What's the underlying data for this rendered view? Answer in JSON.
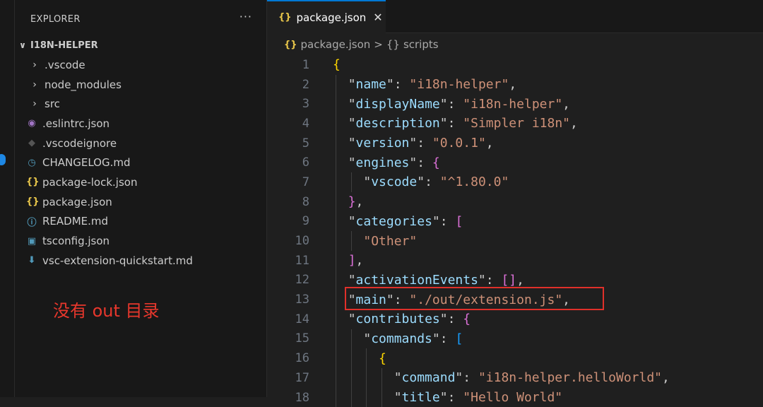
{
  "sidebar": {
    "title": "EXPLORER",
    "more": "···",
    "root": "I18N-HELPER",
    "items": [
      {
        "label": ".vscode",
        "type": "folder",
        "icon": "chevron-right",
        "glyph": "›",
        "color": "#cccccc"
      },
      {
        "label": "node_modules",
        "type": "folder",
        "icon": "chevron-right",
        "glyph": "›",
        "color": "#cccccc"
      },
      {
        "label": "src",
        "type": "folder",
        "icon": "chevron-right",
        "glyph": "›",
        "color": "#cccccc"
      },
      {
        "label": ".eslintrc.json",
        "type": "file",
        "icon": "eslint",
        "glyph": "◉",
        "color": "#a074c4"
      },
      {
        "label": ".vscodeignore",
        "type": "file",
        "icon": "vscodeignore",
        "glyph": "◆",
        "color": "#555555"
      },
      {
        "label": "CHANGELOG.md",
        "type": "file",
        "icon": "changelog",
        "glyph": "◷",
        "color": "#519aba"
      },
      {
        "label": "package-lock.json",
        "type": "file",
        "icon": "json",
        "glyph": "{}",
        "color": "#e8c64a"
      },
      {
        "label": "package.json",
        "type": "file",
        "icon": "json",
        "glyph": "{}",
        "color": "#e8c64a"
      },
      {
        "label": "README.md",
        "type": "file",
        "icon": "info",
        "glyph": "ⓘ",
        "color": "#519aba"
      },
      {
        "label": "tsconfig.json",
        "type": "file",
        "icon": "typescript",
        "glyph": "▣",
        "color": "#519aba"
      },
      {
        "label": "vsc-extension-quickstart.md",
        "type": "file",
        "icon": "download",
        "glyph": "⬇",
        "color": "#519aba"
      }
    ]
  },
  "annotation": "没有 out 目录",
  "tab": {
    "label": "package.json",
    "icon": "{}",
    "close": "✕"
  },
  "breadcrumb": {
    "file": "package.json",
    "sep": ">",
    "symbol_icon": "{}",
    "symbol": "scripts",
    "file_icon": "{}"
  },
  "code": [
    {
      "n": "1",
      "i": 0,
      "t": [
        [
          "{",
          "b1"
        ]
      ]
    },
    {
      "n": "2",
      "i": 1,
      "t": [
        [
          "\"",
          "q"
        ],
        [
          "name",
          "key"
        ],
        [
          "\"",
          "q"
        ],
        [
          ": ",
          "p"
        ],
        [
          "\"i18n-helper\"",
          "str"
        ],
        [
          ",",
          "p"
        ]
      ]
    },
    {
      "n": "3",
      "i": 1,
      "t": [
        [
          "\"",
          "q"
        ],
        [
          "displayName",
          "key"
        ],
        [
          "\"",
          "q"
        ],
        [
          ": ",
          "p"
        ],
        [
          "\"i18n-helper\"",
          "str"
        ],
        [
          ",",
          "p"
        ]
      ]
    },
    {
      "n": "4",
      "i": 1,
      "t": [
        [
          "\"",
          "q"
        ],
        [
          "description",
          "key"
        ],
        [
          "\"",
          "q"
        ],
        [
          ": ",
          "p"
        ],
        [
          "\"Simpler i18n\"",
          "str"
        ],
        [
          ",",
          "p"
        ]
      ]
    },
    {
      "n": "5",
      "i": 1,
      "t": [
        [
          "\"",
          "q"
        ],
        [
          "version",
          "key"
        ],
        [
          "\"",
          "q"
        ],
        [
          ": ",
          "p"
        ],
        [
          "\"0.0.1\"",
          "str"
        ],
        [
          ",",
          "p"
        ]
      ]
    },
    {
      "n": "6",
      "i": 1,
      "t": [
        [
          "\"",
          "q"
        ],
        [
          "engines",
          "key"
        ],
        [
          "\"",
          "q"
        ],
        [
          ": ",
          "p"
        ],
        [
          "{",
          "b2"
        ]
      ]
    },
    {
      "n": "7",
      "i": 2,
      "t": [
        [
          "\"",
          "q"
        ],
        [
          "vscode",
          "key"
        ],
        [
          "\"",
          "q"
        ],
        [
          ": ",
          "p"
        ],
        [
          "\"^1.80.0\"",
          "str"
        ]
      ]
    },
    {
      "n": "8",
      "i": 1,
      "t": [
        [
          "}",
          "b2"
        ],
        [
          ",",
          "p"
        ]
      ]
    },
    {
      "n": "9",
      "i": 1,
      "t": [
        [
          "\"",
          "q"
        ],
        [
          "categories",
          "key"
        ],
        [
          "\"",
          "q"
        ],
        [
          ": ",
          "p"
        ],
        [
          "[",
          "b2"
        ]
      ]
    },
    {
      "n": "10",
      "i": 2,
      "t": [
        [
          "\"Other\"",
          "str"
        ]
      ]
    },
    {
      "n": "11",
      "i": 1,
      "t": [
        [
          "]",
          "b2"
        ],
        [
          ",",
          "p"
        ]
      ]
    },
    {
      "n": "12",
      "i": 1,
      "t": [
        [
          "\"",
          "q"
        ],
        [
          "activationEvents",
          "key"
        ],
        [
          "\"",
          "q"
        ],
        [
          ": ",
          "p"
        ],
        [
          "[]",
          "b2"
        ],
        [
          ",",
          "p"
        ]
      ]
    },
    {
      "n": "13",
      "i": 1,
      "t": [
        [
          "\"",
          "q"
        ],
        [
          "main",
          "key"
        ],
        [
          "\"",
          "q"
        ],
        [
          ": ",
          "p"
        ],
        [
          "\"./out/extension.js\"",
          "str"
        ],
        [
          ",",
          "p"
        ]
      ]
    },
    {
      "n": "14",
      "i": 1,
      "t": [
        [
          "\"",
          "q"
        ],
        [
          "contributes",
          "key"
        ],
        [
          "\"",
          "q"
        ],
        [
          ": ",
          "p"
        ],
        [
          "{",
          "b2"
        ]
      ]
    },
    {
      "n": "15",
      "i": 2,
      "t": [
        [
          "\"",
          "q"
        ],
        [
          "commands",
          "key"
        ],
        [
          "\"",
          "q"
        ],
        [
          ": ",
          "p"
        ],
        [
          "[",
          "b3"
        ]
      ]
    },
    {
      "n": "16",
      "i": 3,
      "t": [
        [
          "{",
          "b1"
        ]
      ]
    },
    {
      "n": "17",
      "i": 4,
      "t": [
        [
          "\"",
          "q"
        ],
        [
          "command",
          "key"
        ],
        [
          "\"",
          "q"
        ],
        [
          ": ",
          "p"
        ],
        [
          "\"i18n-helper.helloWorld\"",
          "str"
        ],
        [
          ",",
          "p"
        ]
      ]
    },
    {
      "n": "18",
      "i": 4,
      "t": [
        [
          "\"",
          "q"
        ],
        [
          "title",
          "key"
        ],
        [
          "\"",
          "q"
        ],
        [
          ": ",
          "p"
        ],
        [
          "\"Hello World\"",
          "str"
        ]
      ]
    }
  ]
}
